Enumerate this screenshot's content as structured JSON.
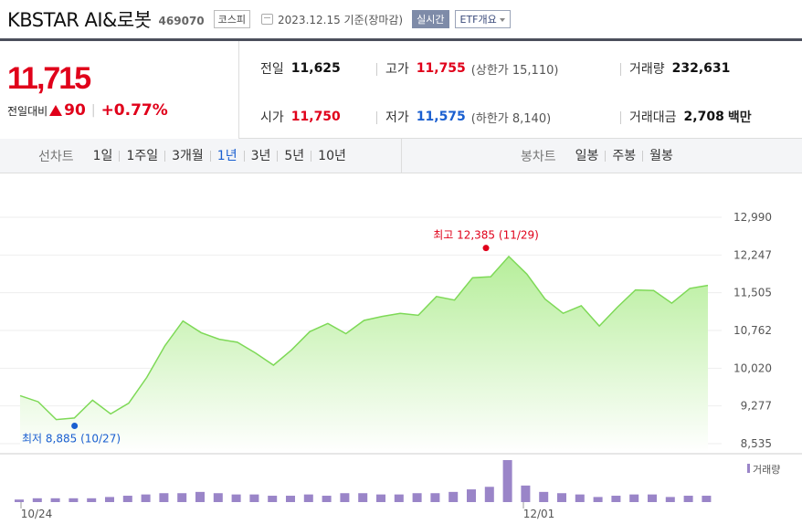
{
  "header": {
    "name": "KBSTAR AI&로봇",
    "code": "469070",
    "market": "코스피",
    "date": "2023.12.15 기준(장마감)",
    "realtime": "실시간",
    "etf": "ETF개요"
  },
  "price": {
    "current": "11,715",
    "change_label": "전일대비",
    "change": "90",
    "change_pct": "+0.77%"
  },
  "stats": {
    "prev_label": "전일",
    "prev": "11,625",
    "high_label": "고가",
    "high": "11,755",
    "upper_limit": "(상한가 15,110)",
    "volume_label": "거래량",
    "volume": "232,631",
    "open_label": "시가",
    "open": "11,750",
    "low_label": "저가",
    "low": "11,575",
    "lower_limit": "(하한가 8,140)",
    "amount_label": "거래대금",
    "amount": "2,708",
    "amount_unit": "백만"
  },
  "toolbar": {
    "line_title": "선차트",
    "line_items": [
      "1일",
      "1주일",
      "3개월",
      "1년",
      "3년",
      "5년",
      "10년"
    ],
    "selected": "1년",
    "candle_title": "봉차트",
    "candle_items": [
      "일봉",
      "주봉",
      "월봉"
    ]
  },
  "colors": {
    "up": "#e0001a",
    "down": "#1a5fd0",
    "line": "#7ed957",
    "volume": "#9a85c8"
  },
  "chart_data": {
    "type": "area",
    "y_ticks": [
      "12,990",
      "12,247",
      "11,505",
      "10,762",
      "10,020",
      "9,277",
      "8,535"
    ],
    "ylim": [
      8535,
      12990
    ],
    "x_labels": [
      "10/24",
      "12/01"
    ],
    "high_annotation": "최고 12,385 (11/29)",
    "low_annotation": "최저 8,885 (10/27)",
    "volume_legend": "거래량",
    "values": [
      9480,
      9360,
      9010,
      9040,
      9390,
      9120,
      9330,
      9840,
      10460,
      10950,
      10720,
      10590,
      10530,
      10320,
      10080,
      10380,
      10740,
      10900,
      10700,
      10960,
      11040,
      11100,
      11060,
      11430,
      11360,
      11800,
      11820,
      12220,
      11870,
      11380,
      11100,
      11250,
      10850,
      11220,
      11560,
      11550,
      11300,
      11590,
      11650
    ],
    "volume": [
      2,
      3,
      3,
      3,
      3,
      4,
      5,
      6,
      7,
      7,
      8,
      7,
      6,
      6,
      5,
      5,
      6,
      5,
      7,
      7,
      6,
      6,
      7,
      7,
      8,
      10,
      12,
      33,
      13,
      8,
      7,
      6,
      4,
      5,
      6,
      6,
      4,
      5,
      5
    ]
  }
}
